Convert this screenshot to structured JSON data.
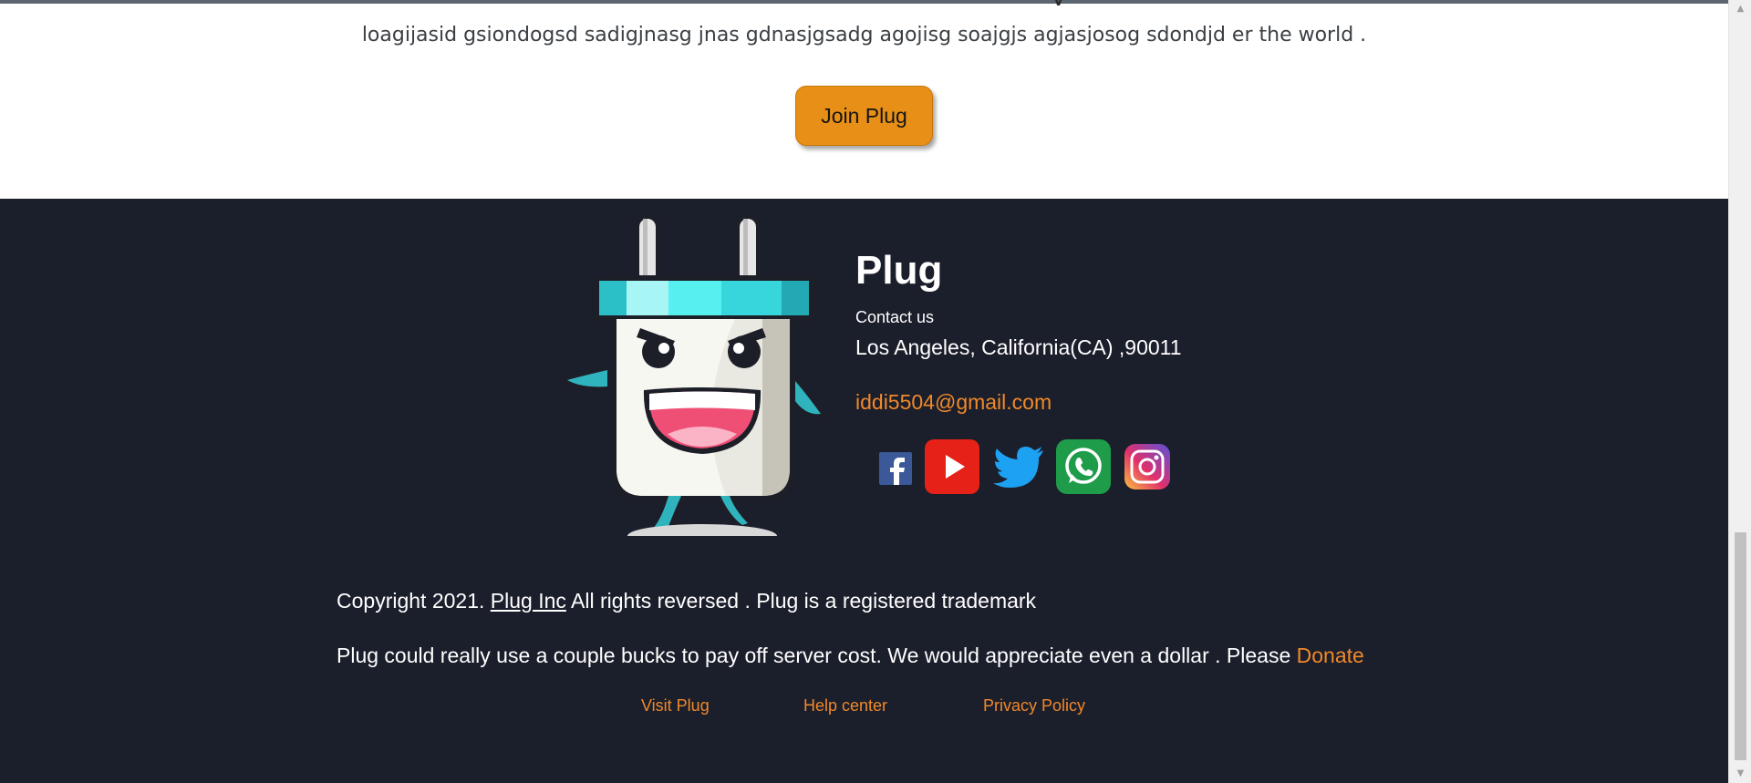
{
  "hero": {
    "tagline": "loagijasid gsiondogsd sadigjnasg jnas gdnasjgsadg agojisg soajgjs agjasjosog sdondjd er the world .",
    "join_button": "Join Plug"
  },
  "footer": {
    "brand": "Plug",
    "contact_label": "Contact us",
    "address": "Los Angeles, California(CA) ,90011",
    "email": "iddi5504@gmail.com",
    "socials": [
      {
        "icon": "facebook-icon",
        "color": "#3b5998"
      },
      {
        "icon": "youtube-icon",
        "color": "#e62117"
      },
      {
        "icon": "twitter-icon",
        "color": "#1da1f2"
      },
      {
        "icon": "whatsapp-icon",
        "color": "#1e9c4a"
      },
      {
        "icon": "instagram-icon",
        "color": "#c13584"
      }
    ],
    "copyright_prefix": "Copyright 2021. ",
    "copyright_link": "Plug Inc",
    "copyright_suffix": " All rights reversed . Plug is a registered trademark",
    "donate_text": "Plug could really use a couple bucks to pay off server cost. We would appreciate even a dollar . Please ",
    "donate_link": "Donate",
    "links": {
      "visit": "Visit Plug",
      "help": "Help center",
      "privacy": "Privacy Policy"
    }
  },
  "colors": {
    "accent": "#f0892a",
    "button": "#e88f17",
    "footer_bg": "#1b1e2b"
  }
}
